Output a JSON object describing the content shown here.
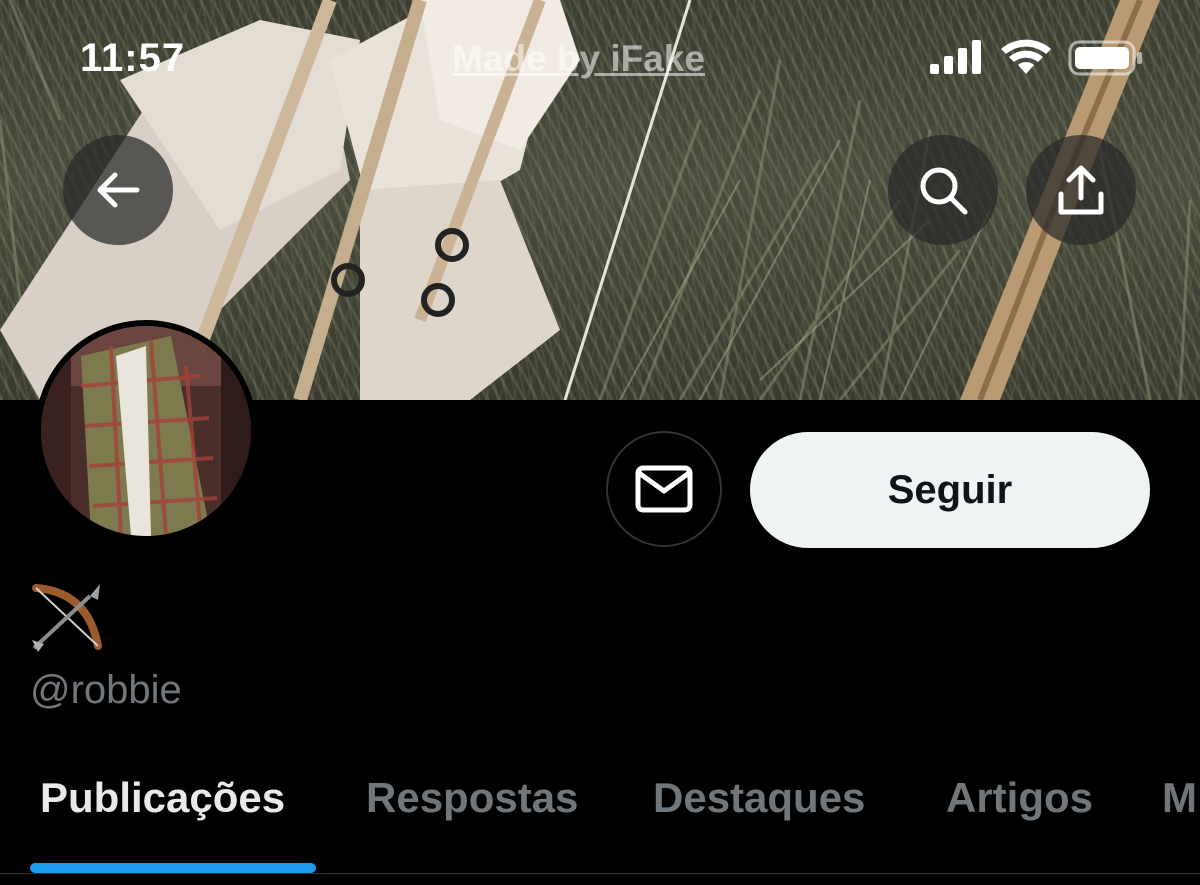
{
  "status_bar": {
    "time": "11:57",
    "watermark": "Made by iFake",
    "icons": [
      "cellular-signal-icon",
      "wifi-icon",
      "battery-icon"
    ]
  },
  "header": {
    "back_icon": "arrow-left-icon",
    "search_icon": "search-icon",
    "share_icon": "share-upload-icon"
  },
  "profile": {
    "display_name_emoji": "🏹",
    "handle": "@robbie",
    "message_icon": "envelope-icon",
    "follow_label": "Seguir"
  },
  "tabs": [
    {
      "label": "Publicações",
      "active": true
    },
    {
      "label": "Respostas",
      "active": false
    },
    {
      "label": "Destaques",
      "active": false
    },
    {
      "label": "Artigos",
      "active": false
    },
    {
      "label": "M",
      "active": false
    }
  ],
  "colors": {
    "background": "#000000",
    "accent": "#1d9bf0",
    "muted_text": "#71767b",
    "follow_button_bg": "#eff3f4"
  }
}
